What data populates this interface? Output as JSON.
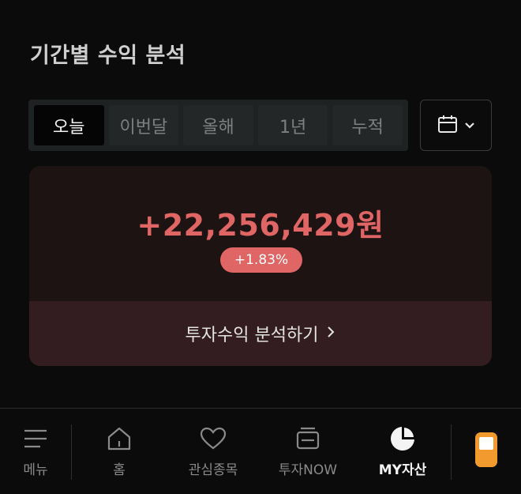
{
  "section": {
    "title": "기간별 수익 분석"
  },
  "period_tabs": [
    {
      "label": "오늘",
      "active": true
    },
    {
      "label": "이번달",
      "active": false
    },
    {
      "label": "올해",
      "active": false
    },
    {
      "label": "1년",
      "active": false
    },
    {
      "label": "누적",
      "active": false
    }
  ],
  "calendar": {
    "icon": "calendar-icon",
    "dropdown_icon": "chevron-down-icon"
  },
  "profit": {
    "amount": "+22,256,429원",
    "rate": "+1.83%",
    "link_label": "투자수익 분석하기",
    "link_icon": "chevron-right-icon"
  },
  "bottom_nav": {
    "menu": "메뉴",
    "home": "홈",
    "favorites": "관심종목",
    "invest_now": "투자NOW",
    "my_assets": "MY자산"
  },
  "colors": {
    "background": "#0b0b0b",
    "profit_red": "#e06565",
    "card_bg": "#1e1313",
    "link_bg": "#331d20",
    "accent_orange": "#f39a2e"
  }
}
